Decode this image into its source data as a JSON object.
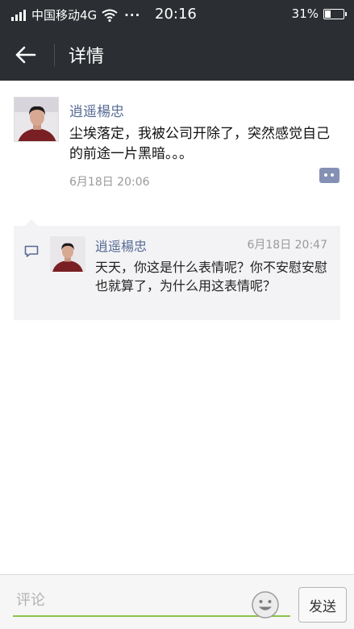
{
  "status_bar": {
    "carrier": "中国移动4G",
    "dots": "···",
    "time": "20:16",
    "battery_percent": "31%",
    "battery_level": 0.31
  },
  "nav": {
    "title": "详情",
    "back_icon": "arrow-left-icon"
  },
  "post": {
    "author": "逍遥楊忠",
    "text": "尘埃落定，我被公司开除了，突然感觉自己的前途一片黑暗。。。",
    "time": "6月18日 20:06",
    "comment_icon": "comment-dots-icon"
  },
  "comments": [
    {
      "author": "逍遥楊忠",
      "time": "6月18日 20:47",
      "text": "天天，你这是什么表情呢？你不安慰安慰也就算了，为什么用这表情呢？"
    }
  ],
  "input": {
    "placeholder": "评论",
    "value": ""
  },
  "send_label": "发送",
  "colors": {
    "bar_bg": "#2b2f33",
    "name_blue": "#576b95",
    "input_underline": "#8bc34a"
  }
}
